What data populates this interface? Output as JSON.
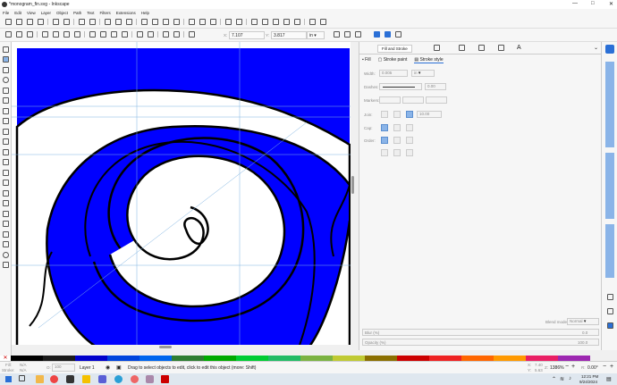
{
  "window": {
    "title": "*monogram_fin.svg - Inkscape"
  },
  "menu": [
    "File",
    "Edit",
    "View",
    "Layer",
    "Object",
    "Path",
    "Text",
    "Filters",
    "Extensions",
    "Help"
  ],
  "toolctrl": {
    "x_label": "X:",
    "x_value": "7.107",
    "y_label": "Y:",
    "y_value": "3.817",
    "w_label": "W:",
    "h_label": "H:",
    "unit": "in"
  },
  "panel": {
    "tabs": [
      "Fill and Stroke"
    ],
    "subtabs": [
      "Fill",
      "Stroke paint",
      "Stroke style"
    ],
    "width_label": "Width:",
    "width_value": "0.005",
    "width_unit": "in",
    "dashes_label": "Dashes:",
    "dashes_value": "0.00",
    "markers_label": "Markers:",
    "join_label": "Join:",
    "join_value": "10.00",
    "cap_label": "Cap:",
    "order_label": "Order:",
    "blend_label": "Blend mode:",
    "blend_value": "Normal",
    "blur_label": "Blur (%)",
    "blur_value": "0.0",
    "opacity_label": "Opacity (%)",
    "opacity_value": "100.0"
  },
  "status": {
    "fill_label": "Fill:",
    "fill_value": "N/A",
    "stroke_label": "Stroke:",
    "stroke_value": "N/A",
    "opacity_label": "O:",
    "opacity_value": "100",
    "layer": "Layer 1",
    "message": "Drag to select objects to edit, click to edit this object (more: Shift)",
    "x_label": "X:",
    "x_value": "7.40",
    "y_label": "Y:",
    "y_value": "5.63",
    "z_label": "Z:",
    "zoom": "1386%",
    "r_label": "R:",
    "rotation": "0.00°"
  },
  "taskbar": {
    "time": "12:21 PM",
    "date": "9/24/2024"
  },
  "palette": [
    "#000000",
    "#1a1a1a",
    "#0000cc",
    "#0044dd",
    "#0066ee",
    "#2e7d32",
    "#00aa00",
    "#00cc33",
    "#22bb66",
    "#7cb342",
    "#c0ca33",
    "#8b6f00",
    "#cc0000",
    "#ee2222",
    "#ff6600",
    "#ff9900",
    "#e91e63",
    "#9c27b0"
  ],
  "colors": {
    "accent": "#2a6fd6",
    "shape": "#0000ff"
  }
}
